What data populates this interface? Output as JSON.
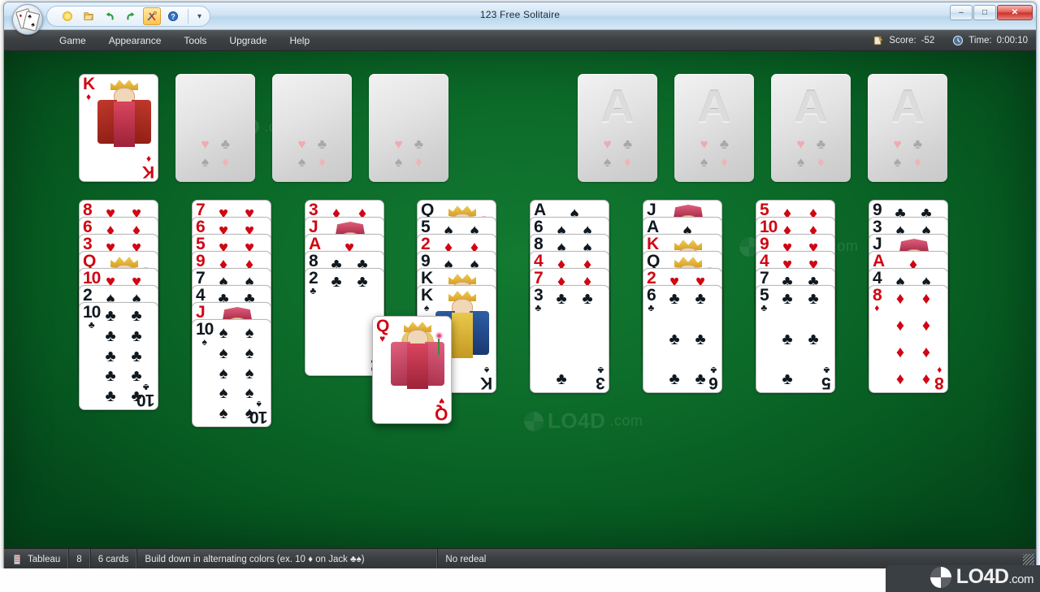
{
  "window": {
    "title": "123 Free Solitaire",
    "minimize_label": "–",
    "maximize_label": "□",
    "close_label": "✕"
  },
  "toolbar": {
    "buttons": [
      {
        "name": "new-game-icon",
        "tip": "New Game"
      },
      {
        "name": "open-game-icon",
        "tip": "Open"
      },
      {
        "name": "undo-icon",
        "tip": "Undo"
      },
      {
        "name": "redo-icon",
        "tip": "Redo"
      },
      {
        "name": "tools-icon",
        "tip": "Tools",
        "active": true
      },
      {
        "name": "help-icon",
        "tip": "Help"
      }
    ],
    "overflow_label": "☰"
  },
  "menu": {
    "items": [
      {
        "label": "Game"
      },
      {
        "label": "Appearance"
      },
      {
        "label": "Tools"
      },
      {
        "label": "Upgrade"
      },
      {
        "label": "Help"
      }
    ]
  },
  "hud": {
    "score_label": "Score:",
    "score_value": "-52",
    "time_label": "Time:",
    "time_value": "0:00:10"
  },
  "statusbar": {
    "pile_label": "Tableau",
    "pile_index": "8",
    "card_count": "6 cards",
    "rule_text": "Build down in alternating colors (ex. 10 ♦ on Jack ♣♠)",
    "redeal_text": "No redeal"
  },
  "watermark": {
    "brand": "LO4D",
    "domain": ".com"
  },
  "board": {
    "free_cells": [
      {
        "name": "free-cell-1",
        "card": {
          "rank": "K",
          "suit": "♦",
          "color": "red",
          "type": "court",
          "art": "king-diamonds"
        }
      },
      {
        "name": "free-cell-2",
        "card": null
      },
      {
        "name": "free-cell-3",
        "card": null
      },
      {
        "name": "free-cell-4",
        "card": null
      }
    ],
    "foundations": [
      {
        "name": "foundation-1",
        "ghost": "A",
        "card": null
      },
      {
        "name": "foundation-2",
        "ghost": "A",
        "card": null
      },
      {
        "name": "foundation-3",
        "ghost": "A",
        "card": null
      },
      {
        "name": "foundation-4",
        "ghost": "A",
        "card": null
      }
    ],
    "empty_slot_pips": [
      "♥",
      "♣",
      "♠",
      "♦"
    ],
    "tableau": [
      {
        "name": "tableau-column-1",
        "cards": [
          {
            "rank": "8",
            "suit": "♥",
            "color": "red"
          },
          {
            "rank": "6",
            "suit": "♦",
            "color": "red"
          },
          {
            "rank": "3",
            "suit": "♥",
            "color": "red"
          },
          {
            "rank": "Q",
            "suit": "♦",
            "color": "red",
            "type": "court"
          },
          {
            "rank": "10",
            "suit": "♥",
            "color": "red"
          },
          {
            "rank": "2",
            "suit": "♠",
            "color": "black"
          },
          {
            "rank": "10",
            "suit": "♣",
            "color": "black",
            "face_up_full": true
          }
        ]
      },
      {
        "name": "tableau-column-2",
        "cards": [
          {
            "rank": "7",
            "suit": "♥",
            "color": "red"
          },
          {
            "rank": "6",
            "suit": "♥",
            "color": "red"
          },
          {
            "rank": "5",
            "suit": "♥",
            "color": "red"
          },
          {
            "rank": "9",
            "suit": "♦",
            "color": "red"
          },
          {
            "rank": "7",
            "suit": "♠",
            "color": "black"
          },
          {
            "rank": "4",
            "suit": "♣",
            "color": "black"
          },
          {
            "rank": "J",
            "suit": "♦",
            "color": "red",
            "type": "court"
          },
          {
            "rank": "10",
            "suit": "♠",
            "color": "black",
            "face_up_full": true
          }
        ]
      },
      {
        "name": "tableau-column-3",
        "cards": [
          {
            "rank": "3",
            "suit": "♦",
            "color": "red"
          },
          {
            "rank": "J",
            "suit": "♥",
            "color": "red",
            "type": "court"
          },
          {
            "rank": "A",
            "suit": "♥",
            "color": "red"
          },
          {
            "rank": "8",
            "suit": "♣",
            "color": "black"
          },
          {
            "rank": "2",
            "suit": "♣",
            "color": "black",
            "face_up_full": true
          }
        ]
      },
      {
        "name": "tableau-column-4",
        "cards": [
          {
            "rank": "Q",
            "suit": "♠",
            "color": "black",
            "type": "court"
          },
          {
            "rank": "5",
            "suit": "♠",
            "color": "black"
          },
          {
            "rank": "2",
            "suit": "♦",
            "color": "red"
          },
          {
            "rank": "9",
            "suit": "♠",
            "color": "black"
          },
          {
            "rank": "K",
            "suit": "♣",
            "color": "black",
            "type": "court"
          },
          {
            "rank": "K",
            "suit": "♠",
            "color": "black",
            "type": "court",
            "face_up_full": true
          }
        ]
      },
      {
        "name": "tableau-column-5",
        "cards": [
          {
            "rank": "A",
            "suit": "♠",
            "color": "black"
          },
          {
            "rank": "6",
            "suit": "♠",
            "color": "black"
          },
          {
            "rank": "8",
            "suit": "♠",
            "color": "black"
          },
          {
            "rank": "4",
            "suit": "♦",
            "color": "red"
          },
          {
            "rank": "7",
            "suit": "♦",
            "color": "red"
          },
          {
            "rank": "3",
            "suit": "♣",
            "color": "black",
            "face_up_full": true
          }
        ]
      },
      {
        "name": "tableau-column-6",
        "cards": [
          {
            "rank": "J",
            "suit": "♠",
            "color": "black",
            "type": "court"
          },
          {
            "rank": "A",
            "suit": "♠",
            "color": "black"
          },
          {
            "rank": "K",
            "suit": "♥",
            "color": "red",
            "type": "court"
          },
          {
            "rank": "Q",
            "suit": "♣",
            "color": "black",
            "type": "court"
          },
          {
            "rank": "2",
            "suit": "♥",
            "color": "red"
          },
          {
            "rank": "6",
            "suit": "♣",
            "color": "black",
            "face_up_full": true
          }
        ]
      },
      {
        "name": "tableau-column-7",
        "cards": [
          {
            "rank": "5",
            "suit": "♦",
            "color": "red"
          },
          {
            "rank": "10",
            "suit": "♦",
            "color": "red"
          },
          {
            "rank": "9",
            "suit": "♥",
            "color": "red"
          },
          {
            "rank": "4",
            "suit": "♥",
            "color": "red"
          },
          {
            "rank": "7",
            "suit": "♣",
            "color": "black"
          },
          {
            "rank": "5",
            "suit": "♣",
            "color": "black",
            "face_up_full": true
          }
        ]
      },
      {
        "name": "tableau-column-8",
        "cards": [
          {
            "rank": "9",
            "suit": "♣",
            "color": "black"
          },
          {
            "rank": "3",
            "suit": "♠",
            "color": "black"
          },
          {
            "rank": "J",
            "suit": "♣",
            "color": "black",
            "type": "court"
          },
          {
            "rank": "A",
            "suit": "♦",
            "color": "red"
          },
          {
            "rank": "4",
            "suit": "♠",
            "color": "black"
          },
          {
            "rank": "8",
            "suit": "♦",
            "color": "red",
            "face_up_full": true
          }
        ]
      }
    ],
    "dragged_card": {
      "name": "dragged-card",
      "rank": "Q",
      "suit": "♥",
      "color": "red",
      "type": "court"
    }
  }
}
